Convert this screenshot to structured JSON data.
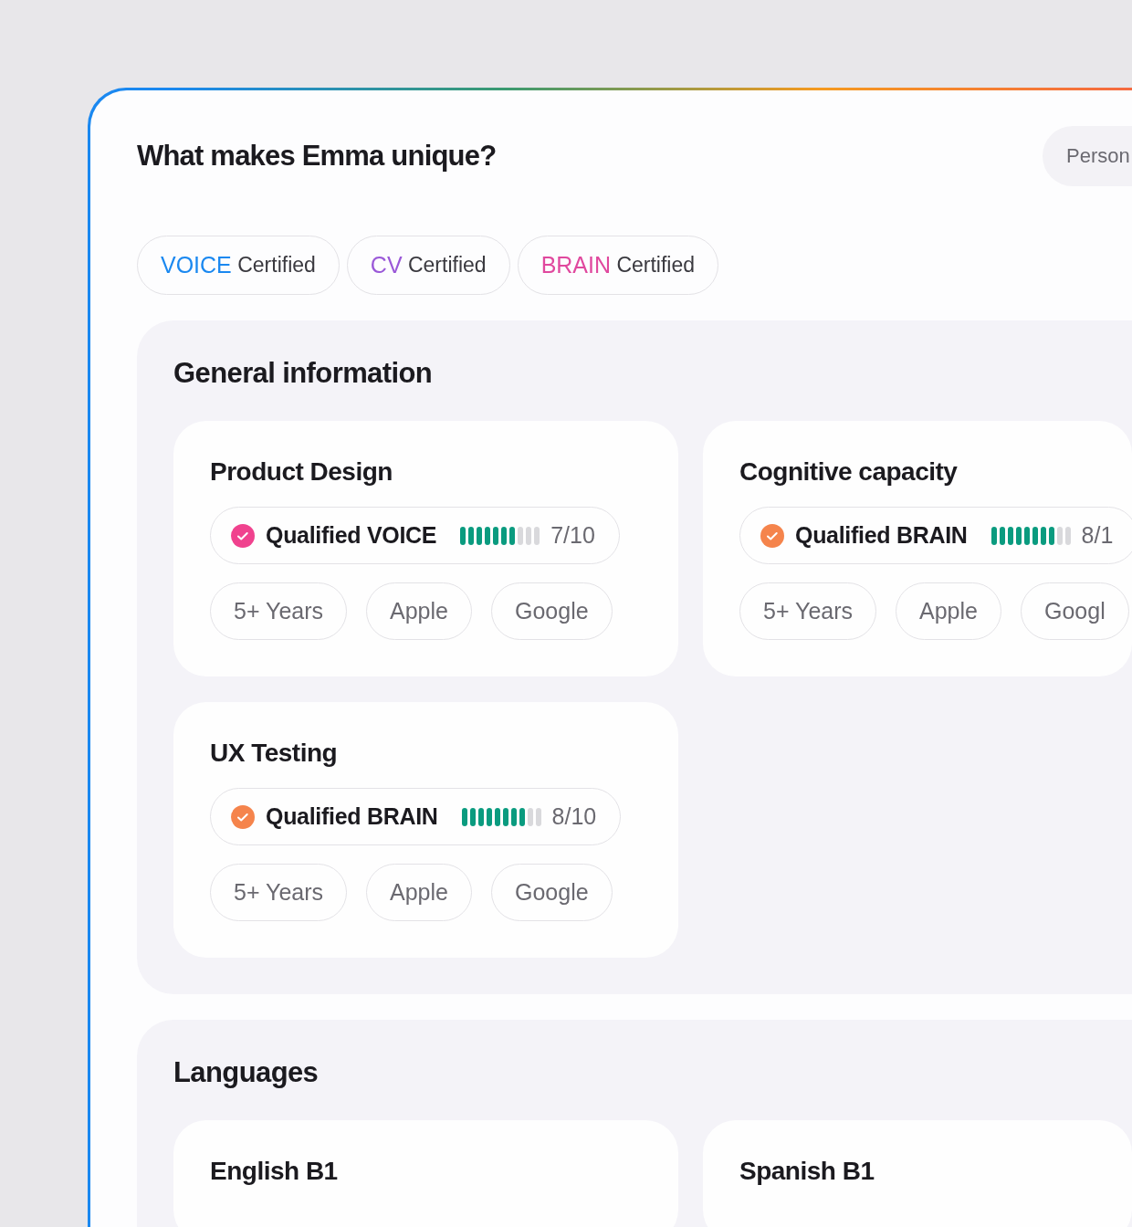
{
  "title": "What makes Emma unique?",
  "header_button": {
    "label": "Person"
  },
  "certifications": [
    {
      "brand": "VOICE",
      "label": "Certified",
      "color": "#1a88f0"
    },
    {
      "brand": "CV",
      "label": "Certified",
      "color": "#9a58d8"
    },
    {
      "brand": "BRAIN",
      "label": "Certified",
      "color": "#e0489e"
    }
  ],
  "sections": [
    {
      "title": "General information",
      "cards": [
        {
          "title": "Product Design",
          "qualification": {
            "label": "Qualified VOICE",
            "color": "#f0428e",
            "level": 0.7,
            "score": "7/10"
          },
          "tags": [
            "5+ Years",
            "Apple",
            "Google"
          ]
        },
        {
          "title": "Cognitive capacity",
          "qualification": {
            "label": "Qualified BRAIN",
            "color": "#f5844c",
            "level": 0.8,
            "score": "8/1"
          },
          "tags": [
            "5+ Years",
            "Apple",
            "Googl"
          ]
        },
        {
          "title": "UX Testing",
          "qualification": {
            "label": "Qualified BRAIN",
            "color": "#f5844c",
            "level": 0.8,
            "score": "8/10"
          },
          "tags": [
            "5+ Years",
            "Apple",
            "Google"
          ]
        }
      ]
    },
    {
      "title": "Languages",
      "cards": [
        {
          "title": "English B1"
        },
        {
          "title": "Spanish B1"
        }
      ]
    }
  ]
}
